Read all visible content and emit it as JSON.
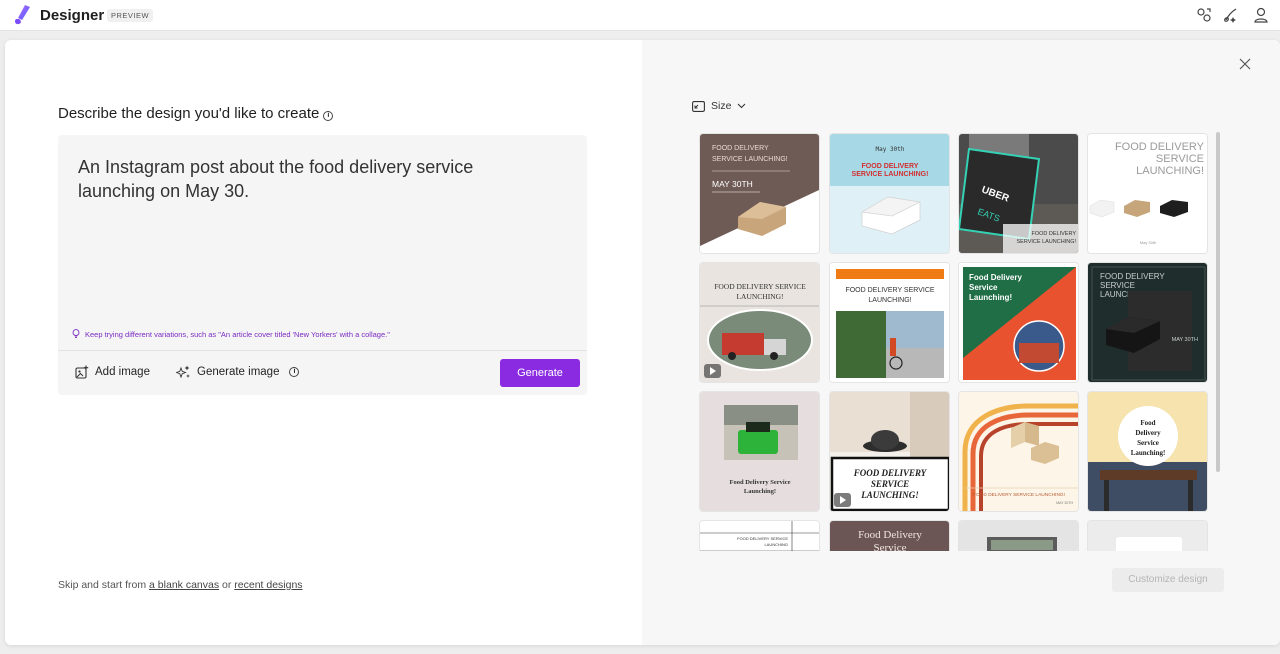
{
  "app": {
    "name": "Designer",
    "badge": "PREVIEW"
  },
  "main": {
    "heading": "Describe the design you'd like to create",
    "prompt": "An Instagram post about the food delivery service launching on May 30.",
    "hint": "Keep trying different variations, such as \"An article cover titled 'New Yorkers' with a collage.\"",
    "add_image_label": "Add image",
    "generate_image_label": "Generate image",
    "generate_button": "Generate",
    "skip_prefix": "Skip and start from ",
    "blank_canvas_link": "a blank canvas",
    "skip_or": " or ",
    "recent_designs_link": "recent designs"
  },
  "gallery": {
    "size_label": "Size",
    "customize_button": "Customize design",
    "designs": [
      {
        "lines": [
          "FOOD DELIVERY",
          "SERVICE LAUNCHING!",
          "MAY 30TH"
        ]
      },
      {
        "lines": [
          "May 30th",
          "FOOD DELIVERY",
          "SERVICE LAUNCHING!"
        ]
      },
      {
        "lines": [
          "UBER",
          "EATS",
          "FOOD DELIVERY",
          "SERVICE LAUNCHING!"
        ]
      },
      {
        "lines": [
          "FOOD DELIVERY",
          "SERVICE",
          "LAUNCHING!",
          "May 30th"
        ]
      },
      {
        "lines": [
          "FOOD DELIVERY SERVICE",
          "LAUNCHING!"
        ]
      },
      {
        "lines": [
          "FOOD DELIVERY SERVICE",
          "LAUNCHING!"
        ]
      },
      {
        "lines": [
          "Food Delivery",
          "Service",
          "Launching!"
        ]
      },
      {
        "lines": [
          "FOOD DELIVERY",
          "SERVICE",
          "LAUNCHING!",
          "MAY 30TH"
        ]
      },
      {
        "lines": [
          "Food Delivery Service",
          "Launching!"
        ]
      },
      {
        "lines": [
          "FOOD DELIVERY",
          "SERVICE",
          "LAUNCHING!"
        ]
      },
      {
        "lines": [
          "FOOD DELIVERY SERVICE LAUNCHING!",
          "MAY 30TH"
        ]
      },
      {
        "lines": [
          "Food",
          "Delivery",
          "Service",
          "Launching!"
        ]
      },
      {
        "lines": [
          "FOOD DELIVERY SERVICE",
          "LAUNCHING"
        ]
      },
      {
        "lines": [
          "Food Delivery",
          "Service"
        ]
      }
    ]
  },
  "colors": {
    "accent": "#8a2be2",
    "hint": "#7a2bc4"
  }
}
